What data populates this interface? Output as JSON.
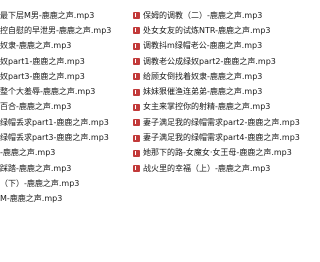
{
  "files": {
    "left": [
      "最下层M男-鹿鹿之声.mp3",
      "控自慰的早泄男-鹿鹿之声.mp3",
      "奴隶-鹿鹿之声.mp3",
      "奴part1-鹿鹿之声.mp3",
      "奴part3-鹿鹿之声.mp3",
      "整个大羞辱-鹿鹿之声.mp3",
      "百合-鹿鹿之声.mp3",
      "绿帽丢求part1-鹿鹿之声.mp3",
      "绿帽丢求part3-鹿鹿之声.mp3",
      "-鹿鹿之声.mp3",
      "踩踏-鹿鹿之声.mp3",
      "（下）-鹿鹿之声.mp3",
      "M-鹿鹿之声.mp3"
    ],
    "right": [
      "保姆的调教（二）-鹿鹿之声.mp3",
      "处女女友的试炼NTR-鹿鹿之声.mp3",
      "调教抖m绿帽老公-鹿鹿之声.mp3",
      "调教老公成绿奴part2-鹿鹿之声.mp3",
      "给顾女倒找着奴隶-鹿鹿之声.mp3",
      "妹妹狠催渔连弟弟-鹿鹿之声.mp3",
      "女主来掌控你的射精-鹿鹿之声.mp3",
      "妻子满足我的绿帽需求part2-鹿鹿之声.mp3",
      "妻子满足我的绿帽需求part4-鹿鹿之声.mp3",
      "她那下的路-女魔女·女王母-鹿鹿之声.mp3",
      "战火里的幸福（上）-鹿鹿之声.mp3"
    ]
  },
  "icon": "mp3-file-icon"
}
